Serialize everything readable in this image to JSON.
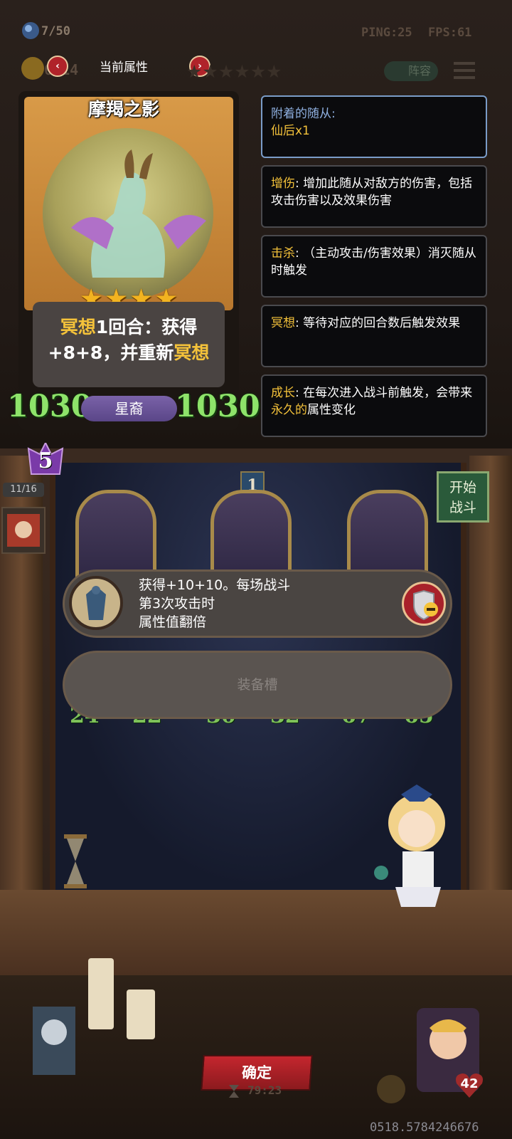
{
  "hud": {
    "population": "7/50",
    "ping": "PING:25",
    "fps": "FPS:61",
    "gold": "6/14",
    "lineup_label": "阵容"
  },
  "attr_tab": {
    "title": "当前属性",
    "star_count": 6
  },
  "card": {
    "name": "摩羯之影",
    "stars": "★★★★",
    "desc_line1_kw": "冥想",
    "desc_line1_rest": "1回合：获得",
    "desc_line2_pre": "+8+8，并重新",
    "desc_line2_kw": "冥想",
    "attack": "1030",
    "health": "1030",
    "type": "星裔"
  },
  "keywords": {
    "attached": {
      "label": "附着的随从:",
      "value": "仙后x1"
    },
    "damage": {
      "keyword": "增伤",
      "text": ": 增加此随从对敌方的伤害，包括攻击伤害以及效果伤害"
    },
    "kill": {
      "keyword": "击杀",
      "text": ": （主动攻击/伤害效果）消灭随从时触发"
    },
    "meditate": {
      "keyword": "冥想",
      "text": ": 等待对应的回合数后触发效果"
    },
    "growth": {
      "keyword": "成长",
      "text_a": ": 在每次进入战斗前触发，会带来",
      "kw2": "永久的",
      "text_b": "属性变化"
    }
  },
  "board": {
    "tier": "5",
    "hand_count": "11/16",
    "slot_number": "1",
    "start_battle": "开始\n战斗",
    "minions": [
      {
        "atk": "24",
        "hp": "22"
      },
      {
        "atk": "30",
        "hp": "32"
      },
      {
        "atk": "67",
        "hp": "65"
      }
    ]
  },
  "equip": {
    "line1": "获得+10+10。每场战斗",
    "line2": "第3次攻击时",
    "line3": "属性值翻倍",
    "slot_label": "装备槽"
  },
  "footer": {
    "confirm": "确定",
    "timer": "79:23",
    "hero_health": "42",
    "player_id": "0518.5784246676"
  },
  "colors": {
    "keyword": "#f4c23a",
    "stat_green": "#8ee36a",
    "confirm_red": "#c4262e"
  }
}
